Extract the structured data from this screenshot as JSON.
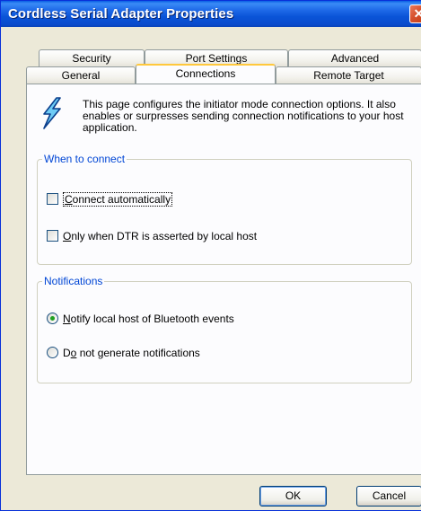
{
  "window": {
    "title": "Cordless Serial Adapter Properties",
    "close_glyph": "✕"
  },
  "tabs": {
    "row1": [
      "Security",
      "Port Settings",
      "Advanced"
    ],
    "row2": [
      "General",
      "Connections",
      "Remote Target"
    ],
    "active": "Connections"
  },
  "info": {
    "icon": "lightning-bolt-icon",
    "text": "This page configures the initiator mode connection options. It also enables or surpresses sending connection notifications to your host application."
  },
  "when_to_connect": {
    "title": "When to connect",
    "options": [
      {
        "pre": "",
        "mnemonic": "C",
        "post": "onnect automatically",
        "checked": false,
        "focused": true
      },
      {
        "pre": "",
        "mnemonic": "O",
        "post": "nly when DTR is asserted by local host",
        "checked": false,
        "focused": false
      }
    ]
  },
  "notifications": {
    "title": "Notifications",
    "options": [
      {
        "pre": "",
        "mnemonic": "N",
        "post": "otify local host of Bluetooth events",
        "selected": true
      },
      {
        "pre": "D",
        "mnemonic": "o",
        "post": " not generate notifications",
        "selected": false
      }
    ]
  },
  "buttons": {
    "ok": "OK",
    "cancel": "Cancel"
  },
  "colors": {
    "group_title": "#0046d5",
    "titlebar": "#0a54d8",
    "active_tab_accent": "#ffc83c"
  }
}
